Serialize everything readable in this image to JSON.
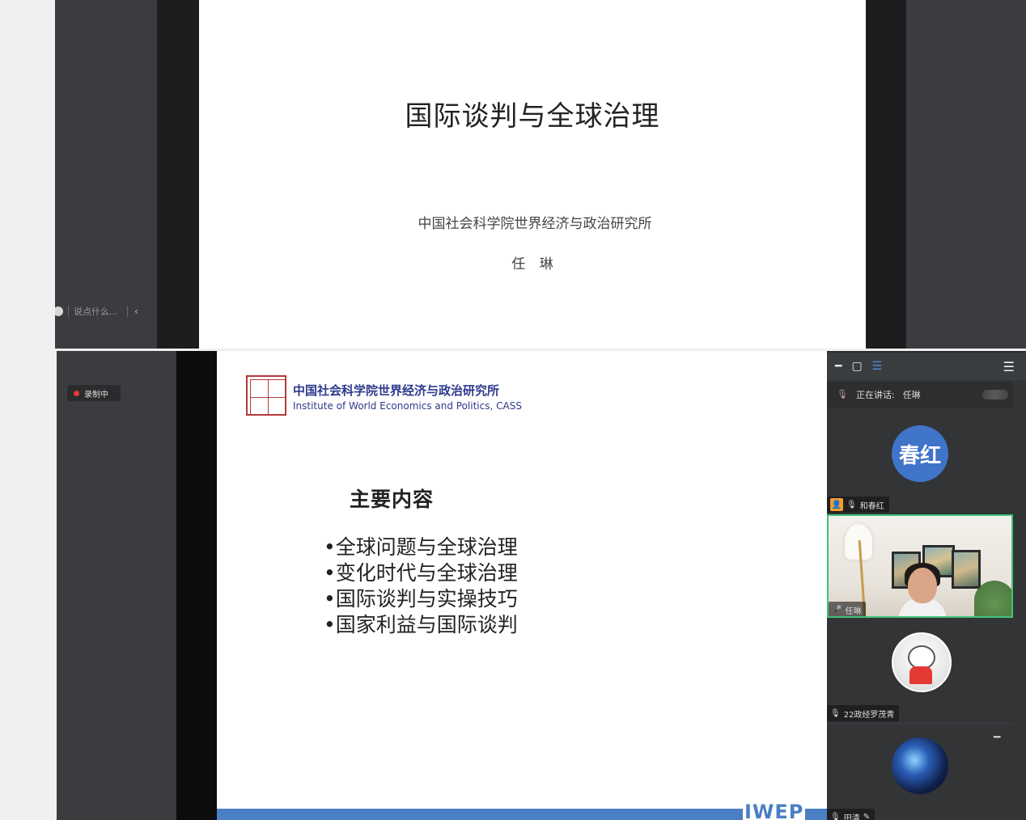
{
  "top_screen": {
    "slide": {
      "title": "国际谈判与全球治理",
      "institute": "中国社会科学院世界经济与政治研究所",
      "author": "任 琳"
    },
    "chat": {
      "placeholder": "说点什么...",
      "collapse_icon": "‹"
    },
    "expand_icon": "‹"
  },
  "bottom_screen": {
    "recording_label": "录制中",
    "slide": {
      "institute_cn": "中国社会科学院世界经济与政治研究所",
      "institute_en": "Institute of World Economics and Politics, CASS",
      "heading": "主要内容",
      "items": [
        "•全球问题与全球治理",
        "•变化时代与全球治理",
        "•国际谈判与实操技巧",
        "•国家利益与国际谈判"
      ],
      "footer_text": "IWEP"
    },
    "panel": {
      "toolbar_icons": [
        "minimize-icon",
        "window-icon",
        "list-view-icon",
        "menu-icon"
      ],
      "speaking_label": "正在讲话:",
      "speaking_name": "任琳",
      "participants": [
        {
          "avatar_text": "春红",
          "name": "和春红",
          "role": "host"
        },
        {
          "name": "任琳",
          "video": true
        },
        {
          "name": "22政经罗茂青"
        },
        {
          "name": "田清"
        }
      ],
      "accent_color": "#3ec47a",
      "avatar_color": "#3f74c8"
    }
  }
}
